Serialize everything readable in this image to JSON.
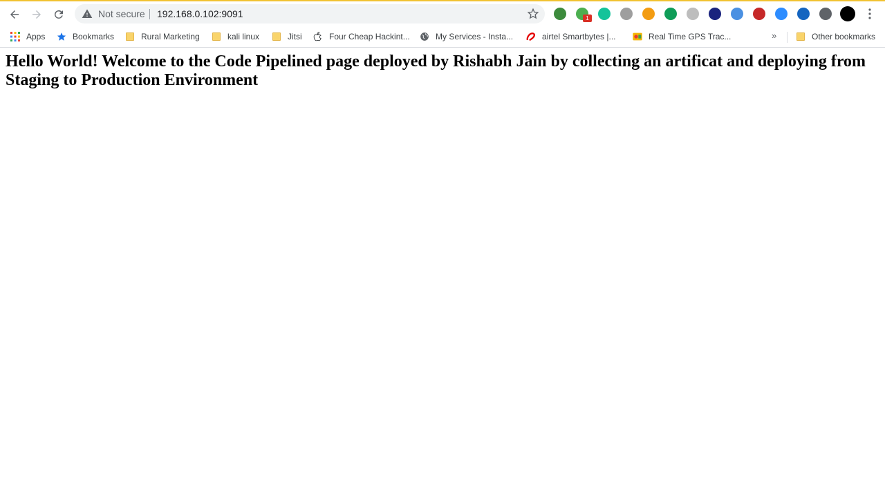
{
  "address_bar": {
    "security_label": "Not secure",
    "url": "192.168.0.102:9091"
  },
  "extensions": [
    {
      "name": "ext-1-icon",
      "color": "#3d8b3d"
    },
    {
      "name": "ext-2-icon",
      "color": "#4caf50",
      "badge": "1"
    },
    {
      "name": "grammarly-icon",
      "color": "#15c39a"
    },
    {
      "name": "cart-icon",
      "color": "#9e9e9e"
    },
    {
      "name": "ext-orange-icon",
      "color": "#f39c12"
    },
    {
      "name": "ext-green-icon",
      "color": "#0f9d58"
    },
    {
      "name": "code-icon",
      "color": "#bdbdbd"
    },
    {
      "name": "ext-navy-icon",
      "color": "#1a237e"
    },
    {
      "name": "feather-icon",
      "color": "#4a90e2"
    },
    {
      "name": "pdf-icon",
      "color": "#c62828"
    },
    {
      "name": "zoom-icon",
      "color": "#2d8cff"
    },
    {
      "name": "ext-blue-icon",
      "color": "#1565c0"
    },
    {
      "name": "puzzle-icon",
      "color": "#5f6368"
    }
  ],
  "bookmarks": {
    "items": [
      {
        "label": "Apps",
        "icon": "apps-grid-icon"
      },
      {
        "label": "Bookmarks",
        "icon": "star-icon"
      },
      {
        "label": "Rural Marketing",
        "icon": "folder-icon"
      },
      {
        "label": "kali linux",
        "icon": "folder-icon"
      },
      {
        "label": "Jitsi",
        "icon": "folder-icon"
      },
      {
        "label": "Four Cheap Hackint...",
        "icon": "apple-icon"
      },
      {
        "label": "My Services - Insta...",
        "icon": "globe-icon"
      },
      {
        "label": "airtel Smartbytes |...",
        "icon": "airtel-icon"
      },
      {
        "label": "Real Time GPS Trac...",
        "icon": "gps-icon"
      }
    ],
    "more": "»",
    "other": "Other bookmarks"
  },
  "page": {
    "heading": "Hello World! Welcome to the Code Pipelined page deployed by Rishabh Jain by collecting an artificat and deploying from Staging to Production Environment"
  },
  "colors": {
    "accent_top": "#f1c232",
    "omnibox_bg": "#f1f3f4"
  }
}
